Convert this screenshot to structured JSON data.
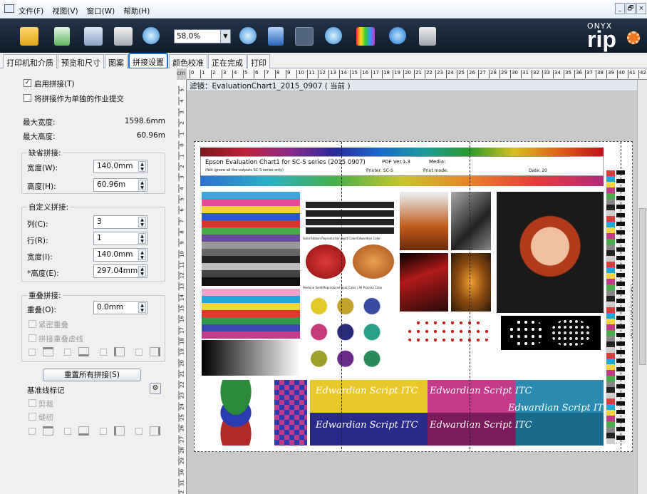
{
  "window": {
    "menu": [
      "文件(F)",
      "视图(V)",
      "窗口(W)",
      "帮助(H)"
    ],
    "controls": [
      "_",
      "🗗",
      "×"
    ]
  },
  "toolbar": {
    "zoom_value": "58.0%",
    "brand_top": "ONYX",
    "brand_main": "rip"
  },
  "tabs": [
    "打印机和介质",
    "预览和尺寸",
    "图案",
    "拼接设置",
    "颜色校准",
    "正在完成",
    "打印"
  ],
  "active_tab": "拼接设置",
  "panel": {
    "enable_tiling": "启用拼接(T)",
    "separate_job": "将拼接作为单独的作业提交",
    "max_width_label": "最大宽度:",
    "max_width_value": "1598.6mm",
    "max_height_label": "最大高度:",
    "max_height_value": "60.96m",
    "default_tiling": {
      "title": "缺省拼接:",
      "width_label": "宽度(W):",
      "width_value": "140.0mm",
      "height_label": "高度(H):",
      "height_value": "60.96m"
    },
    "custom_tiling": {
      "title": "自定义拼接:",
      "cols_label": "列(C):",
      "cols_value": "3",
      "rows_label": "行(R):",
      "rows_value": "1",
      "width_label": "宽度(I):",
      "width_value": "140.0mm",
      "height_label": "*高度(E):",
      "height_value": "297.04mm"
    },
    "overlap": {
      "title": "重叠拼接:",
      "overlap_label": "重叠(O):",
      "overlap_value": "0.0mm",
      "tight_overlap": "紧密重叠",
      "overlap_dashed": "拼接重叠虚线"
    },
    "reset_button": "重置所有拼接(S)",
    "baseline": {
      "title": "基准线标记",
      "cut": "剪裁",
      "sew": "缝纫"
    }
  },
  "preview": {
    "ruler_unit": "cm",
    "ruler_ticks": [
      "0",
      "1",
      "2",
      "3",
      "4",
      "5",
      "6",
      "7",
      "8",
      "9",
      "10",
      "11",
      "12",
      "13",
      "14",
      "15",
      "16",
      "17",
      "18",
      "19",
      "20",
      "21",
      "22",
      "23",
      "24",
      "25",
      "26",
      "27",
      "28",
      "29",
      "30",
      "31",
      "32",
      "33",
      "34",
      "35",
      "36",
      "37",
      "38",
      "39",
      "40",
      "41",
      "42"
    ],
    "vruler_ticks": [
      "5",
      "4",
      "3",
      "2",
      "1",
      "0",
      "1",
      "2",
      "3",
      "4",
      "5",
      "6",
      "7",
      "8",
      "9",
      "10",
      "11",
      "12",
      "13",
      "14",
      "15",
      "16",
      "17",
      "18",
      "19",
      "20",
      "21",
      "22",
      "23",
      "24",
      "25",
      "26",
      "27",
      "28",
      "29",
      "30",
      "31",
      "32"
    ],
    "job_label": "滤镜：EvaluationChart1_2015_0907 ( 当前 )",
    "chart_title": "Epson Evaluation Chart1 for SC-S series (2015 0907)",
    "chart_version": "PDF Ver.1.3",
    "chart_media": "Media:",
    "chart_printer": "Printer: SC-S",
    "chart_printmode": "Print mode:",
    "chart_date": "Date: 20",
    "chart_subtitle": "(Not ignore all the outputs SC-S series only)",
    "labels": {
      "spot": "Solid Ribbon Reproduction Spot Color/Edwardian Color",
      "pantone": "Pantone Solid/Reproduced Spot Color / All Process Color",
      "edwardian": "Edwardian Script ITC",
      "vertical": "Chart Dr.S-30 White Tint Chart"
    }
  }
}
